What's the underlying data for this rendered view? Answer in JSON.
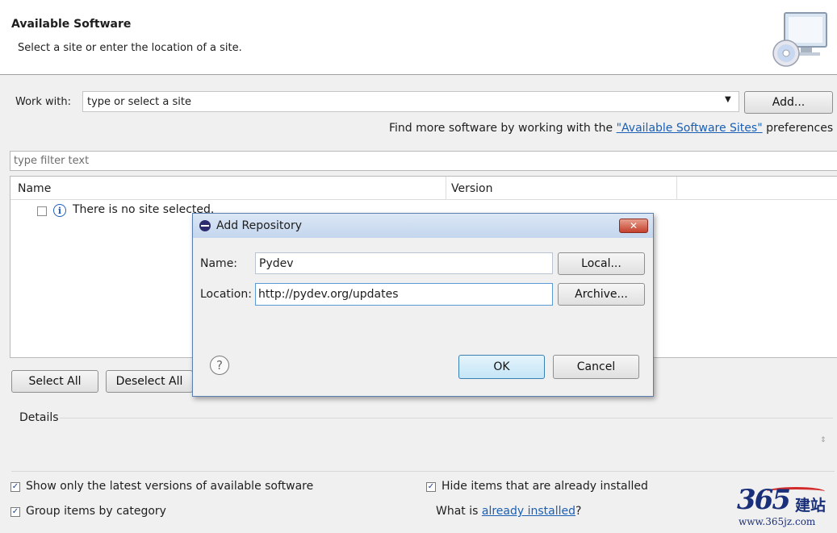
{
  "header": {
    "title": "Available Software",
    "subtitle": "Select a site or enter the location of a site."
  },
  "work_with": {
    "label": "Work with:",
    "value": "type or select a site",
    "add_button": "Add..."
  },
  "find_more": {
    "prefix": "Find more software by working with the ",
    "link": "\"Available Software Sites\"",
    "suffix": " preferences"
  },
  "filter": {
    "placeholder": "type filter text"
  },
  "table": {
    "columns": [
      "Name",
      "Version"
    ],
    "rows": [
      {
        "text": "There is no site selected."
      }
    ]
  },
  "buttons": {
    "select_all": "Select All",
    "deselect_all": "Deselect All"
  },
  "details": {
    "label": "Details"
  },
  "options": {
    "show_latest": {
      "label": "Show only the latest versions of available software",
      "checked": true
    },
    "hide_installed": {
      "label": "Hide items that are already installed",
      "checked": true
    },
    "group_by_category": {
      "label": "Group items by category",
      "checked": true
    },
    "what_is_prefix": "What is ",
    "what_is_link": "already installed",
    "what_is_suffix": "?"
  },
  "dialog": {
    "title": "Add Repository",
    "close_glyph": "✕",
    "name_label": "Name:",
    "name_value": "Pydev",
    "location_label": "Location:",
    "location_value": "http://pydev.org/updates",
    "local_button": "Local...",
    "archive_button": "Archive...",
    "help_glyph": "?",
    "ok_button": "OK",
    "cancel_button": "Cancel"
  },
  "watermark": {
    "number": "365",
    "cn": "建站",
    "url": "www.365jz.com"
  },
  "colors": {
    "link": "#1a5fb4",
    "dialog_border": "#5a7fb0",
    "ok_button_border": "#3c7fb1",
    "close_button": "#c4402c",
    "watermark": "#1a2f7a"
  }
}
